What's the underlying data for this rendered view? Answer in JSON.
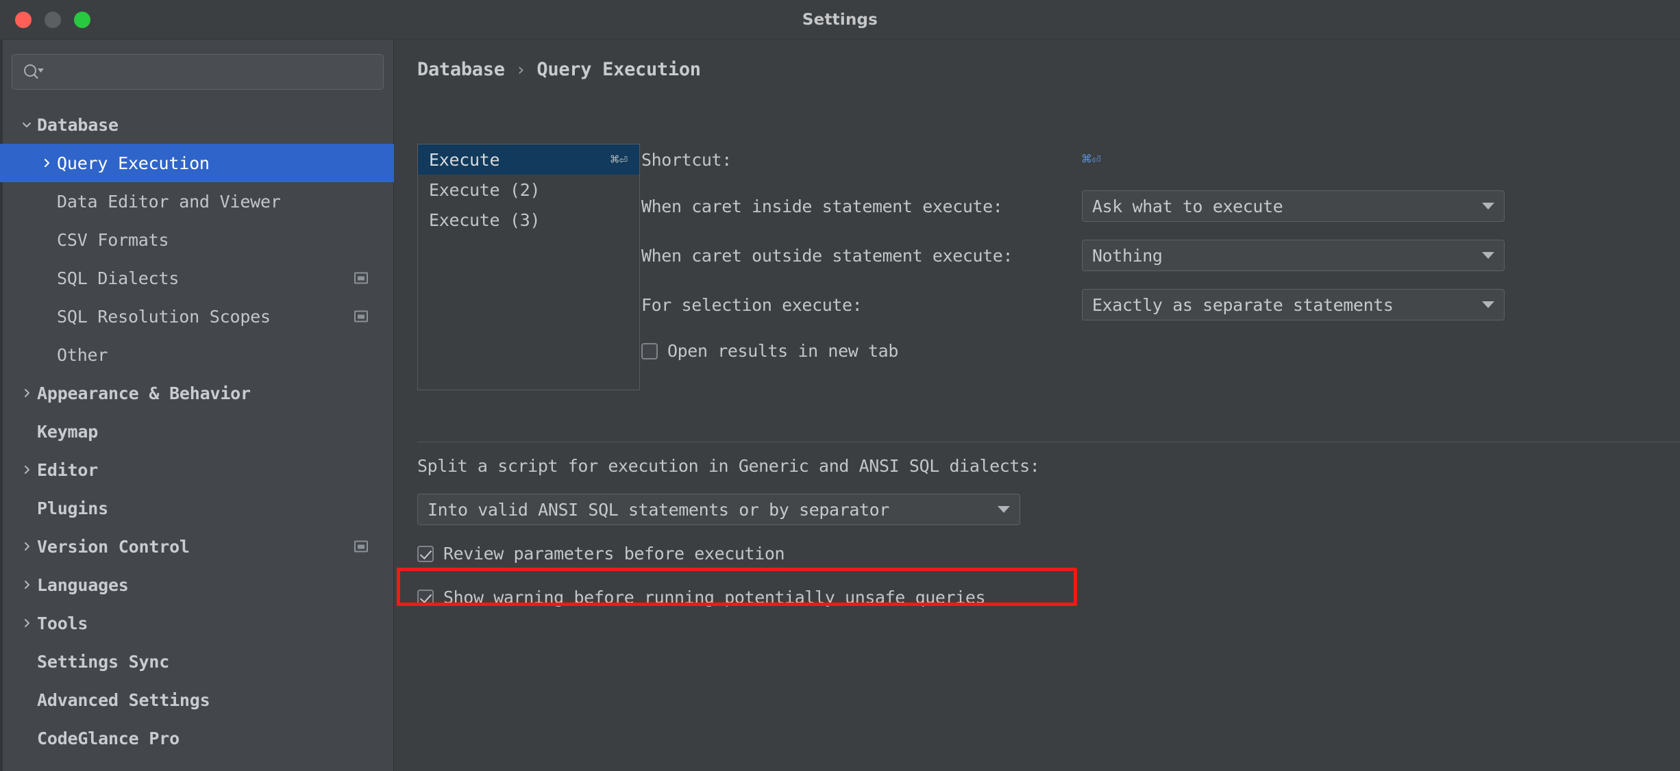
{
  "window": {
    "title": "Settings",
    "traffic_lights": [
      "close-red",
      "minimize-yellow",
      "zoom-green"
    ]
  },
  "sidebar": {
    "search": {
      "value": "",
      "placeholder": "",
      "icon": "search-icon"
    },
    "items": [
      {
        "label": "Database",
        "level": 0,
        "arrow": "down",
        "selected": false,
        "marker": false
      },
      {
        "label": "Query Execution",
        "level": 1,
        "arrow": "right",
        "selected": true,
        "marker": false
      },
      {
        "label": "Data Editor and Viewer",
        "level": 1,
        "arrow": "none",
        "selected": false,
        "marker": false
      },
      {
        "label": "CSV Formats",
        "level": 1,
        "arrow": "none",
        "selected": false,
        "marker": false
      },
      {
        "label": "SQL Dialects",
        "level": 1,
        "arrow": "none",
        "selected": false,
        "marker": true
      },
      {
        "label": "SQL Resolution Scopes",
        "level": 1,
        "arrow": "none",
        "selected": false,
        "marker": true
      },
      {
        "label": "Other",
        "level": 1,
        "arrow": "none",
        "selected": false,
        "marker": false
      },
      {
        "label": "Appearance & Behavior",
        "level": 0,
        "arrow": "right",
        "selected": false,
        "marker": false
      },
      {
        "label": "Keymap",
        "level": 0,
        "arrow": "none",
        "selected": false,
        "marker": false
      },
      {
        "label": "Editor",
        "level": 0,
        "arrow": "right",
        "selected": false,
        "marker": false
      },
      {
        "label": "Plugins",
        "level": 0,
        "arrow": "none",
        "selected": false,
        "marker": false
      },
      {
        "label": "Version Control",
        "level": 0,
        "arrow": "right",
        "selected": false,
        "marker": true
      },
      {
        "label": "Languages",
        "level": 0,
        "arrow": "right",
        "selected": false,
        "marker": false
      },
      {
        "label": "Tools",
        "level": 0,
        "arrow": "right",
        "selected": false,
        "marker": false
      },
      {
        "label": "Settings Sync",
        "level": 0,
        "arrow": "none",
        "selected": false,
        "marker": false
      },
      {
        "label": "Advanced Settings",
        "level": 0,
        "arrow": "none",
        "selected": false,
        "marker": false
      },
      {
        "label": "CodeGlance Pro",
        "level": 0,
        "arrow": "none",
        "selected": false,
        "marker": false
      }
    ]
  },
  "main": {
    "breadcrumb": {
      "root": "Database",
      "separator": "›",
      "leaf": "Query Execution"
    },
    "config_list": [
      {
        "label": "Execute",
        "shortcut": "⌘⏎",
        "selected": true
      },
      {
        "label": "Execute (2)",
        "shortcut": "",
        "selected": false
      },
      {
        "label": "Execute (3)",
        "shortcut": "",
        "selected": false
      }
    ],
    "fields": {
      "shortcut_label": "Shortcut:",
      "shortcut_value": "⌘⏎",
      "caret_inside_label": "When caret inside statement execute:",
      "caret_inside_value": "Ask what to execute",
      "caret_outside_label": "When caret outside statement execute:",
      "caret_outside_value": "Nothing",
      "selection_label": "For selection execute:",
      "selection_value": "Exactly as separate statements",
      "open_results_label": "Open results in new tab",
      "open_results_checked": false
    },
    "split_section": {
      "text": "Split a script for execution in Generic and ANSI SQL dialects:",
      "value": "Into valid ANSI SQL statements or by separator"
    },
    "checkboxes": [
      {
        "label": "Review parameters before execution",
        "checked": true,
        "highlighted": false
      },
      {
        "label": "Show warning before running potentially unsafe queries",
        "checked": true,
        "highlighted": true
      }
    ]
  },
  "colors": {
    "window_bg": "#3c3f41",
    "sidebar_bg": "#43474c",
    "selection_blue": "#2f65ca",
    "list_selection": "#113a5c",
    "accent_link": "#5a91d6",
    "highlight_red": "#f01a1a",
    "text": "#c3c6c9"
  }
}
